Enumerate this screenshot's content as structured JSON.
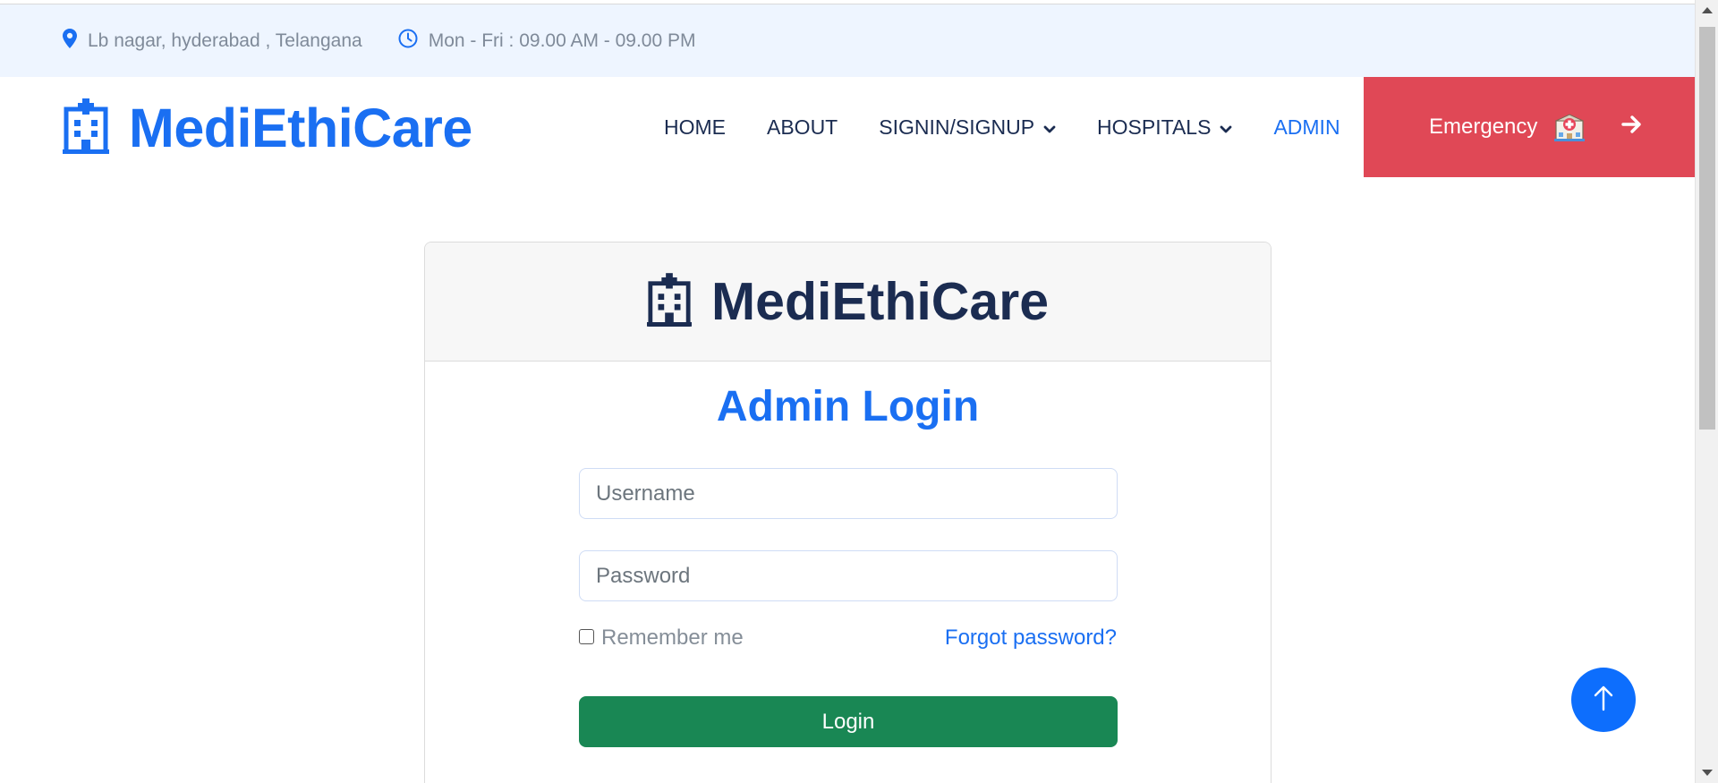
{
  "topbar": {
    "location": "Lb nagar, hyderabad , Telangana",
    "hours": "Mon - Fri : 09.00 AM - 09.00 PM",
    "icons": [
      "map-pin-icon",
      "clock-icon"
    ]
  },
  "navbar": {
    "brand": "MediEthiCare",
    "links": [
      {
        "label": "HOME"
      },
      {
        "label": "ABOUT"
      },
      {
        "label": "SIGNIN/SIGNUP"
      },
      {
        "label": "HOSPITALS"
      },
      {
        "label": "ADMIN"
      }
    ],
    "emergency_label": "Emergency",
    "colors": {
      "brand": "#1a6ff2",
      "emergency": "#e04856"
    }
  },
  "card": {
    "brand": "MediEthiCare",
    "title": "Admin Login",
    "username_placeholder": "Username",
    "password_placeholder": "Password",
    "remember_label": "Remember me",
    "forgot_label": "Forgot password?",
    "login_label": "Login",
    "colors": {
      "login": "#198754",
      "title": "#1a6ff2"
    }
  }
}
